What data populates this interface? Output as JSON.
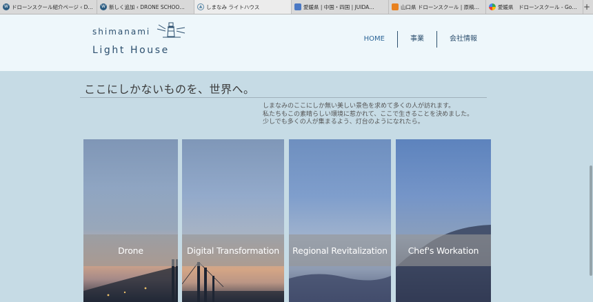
{
  "browser": {
    "tabs": [
      {
        "label": "ドローンスクール紹介ページ ‹ D…",
        "icon": "wordpress-icon"
      },
      {
        "label": "新しく追加 ‹ DRONE SCHOO…",
        "icon": "wordpress-icon"
      },
      {
        "label": "しまなみ ライトハウス",
        "icon": "lighthouse-icon",
        "active": true
      },
      {
        "label": "愛媛県 | 中国・四国 | JUIDA…",
        "icon": "page-icon"
      },
      {
        "label": "山口県 ドローンスクール | 原稿…",
        "icon": "fire-icon"
      },
      {
        "label": "愛媛県　ドローンスクール - Go…",
        "icon": "maps-icon"
      }
    ],
    "new_tab_label": "+"
  },
  "header": {
    "logo_top": "shimanami",
    "logo_bottom": "Light House",
    "nav": [
      {
        "label": "HOME"
      },
      {
        "label": "事業"
      },
      {
        "label": "会社情報"
      }
    ]
  },
  "main": {
    "headline": "ここにしかないものを、世界へ。",
    "intro_lines": [
      "しまなみのここにしか無い美しい景色を求めて多くの人が訪れます。",
      "私たちもこの素晴らしい環境に惹かれて、ここで生きることを決めました。",
      "少しでも多くの人が集まるよう、灯台のようになれたら。"
    ],
    "cards": [
      {
        "label": "Drone"
      },
      {
        "label": "Digital Transformation"
      },
      {
        "label": "Regional Revitalization"
      },
      {
        "label": "Chef's Workation"
      }
    ]
  },
  "colors": {
    "page_bg": "#c6dbe5",
    "header_bg": "#eef7fb",
    "brand": "#2c4f6e",
    "card_band": "rgba(150,150,150,0.62)"
  }
}
